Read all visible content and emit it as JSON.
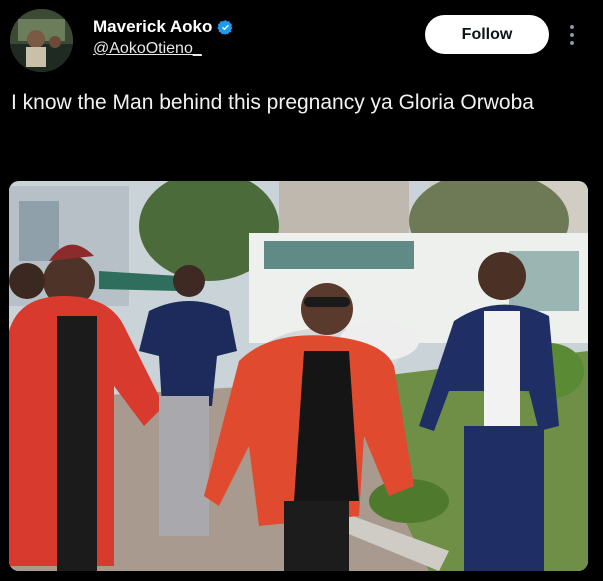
{
  "author": {
    "display_name": "Maverick Aoko",
    "handle": "@AokoOtieno_",
    "verified_icon": "verified-badge-icon"
  },
  "actions": {
    "follow_label": "Follow",
    "more_icon": "more-options-icon"
  },
  "tweet": {
    "text": "I know the Man behind this pregnancy ya Gloria Orwoba"
  },
  "media": {
    "icon": "photo-image"
  },
  "colors": {
    "background": "#000000",
    "verified_blue": "#1d9bf0",
    "button_bg": "#ffffff",
    "text": "#e7e9ea"
  }
}
